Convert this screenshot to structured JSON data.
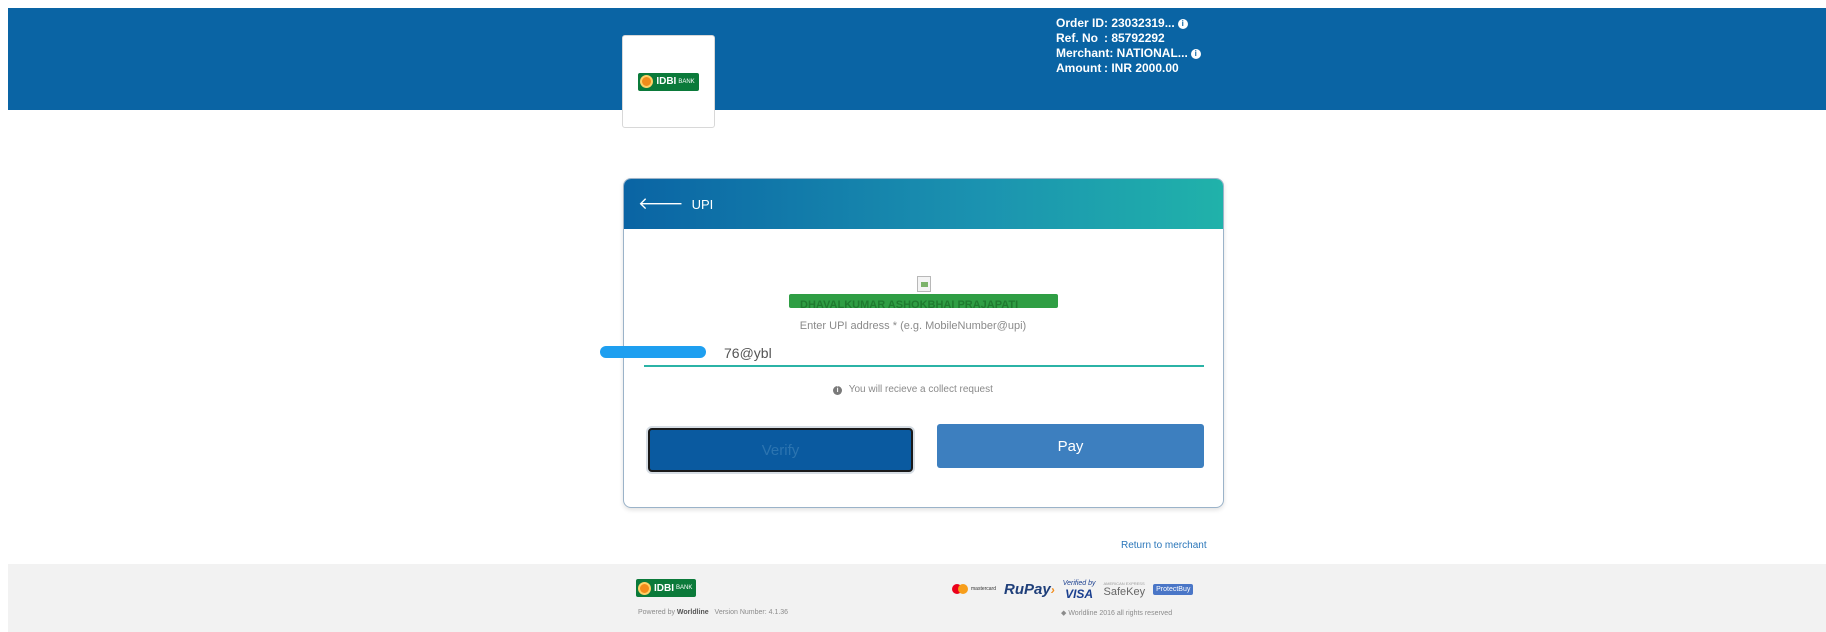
{
  "header": {
    "logo_text": "IDBI",
    "logo_sub": "BANK",
    "order_id_label": "Order ID",
    "order_id_value": ": 23032319...",
    "ref_label": "Ref. No",
    "ref_value": ": 85792292",
    "merchant_label": "Merchant",
    "merchant_value": ": NATIONAL...",
    "amount_label": "Amount",
    "amount_value": ": INR 2000.00",
    "info_glyph": "i"
  },
  "card": {
    "title": "UPI",
    "back_glyph": "🡐",
    "payee_name": "DHAVALKUMAR ASHOKBHAI PRAJAPATI",
    "upi_label": "Enter UPI address *",
    "upi_example": "(e.g. MobileNumber@upi)",
    "upi_value": "76@ybl",
    "collect_note": "You will recieve a collect request",
    "note_glyph": "i",
    "verify_label": "Verify",
    "pay_label": "Pay"
  },
  "return_link": "Return to merchant",
  "footer": {
    "logo_text": "IDBI",
    "logo_sub": "BANK",
    "powered_prefix": "Powered by",
    "powered_brand": "Worldline",
    "version": "Version Number: 4.1.36",
    "rights": "◆ Worldline 2016 all rights reserved",
    "payment_logos": {
      "mastercard": "mastercard",
      "rupay": "RuPay",
      "visa_top": "Verified by",
      "visa_bottom": "VISA",
      "safekey": "SafeKey",
      "safekey_sub": "AMERICAN EXPRESS",
      "diners": "ProtectBuy"
    }
  },
  "colors": {
    "header_bg": "#0a64a4",
    "accent_teal": "#20b2aa",
    "pay_button": "#3d7fbf",
    "link": "#2a76b9"
  },
  "icons": [
    "back-arrow-icon",
    "info-icon",
    "idbi-bank-logo",
    "broken-image-icon"
  ]
}
